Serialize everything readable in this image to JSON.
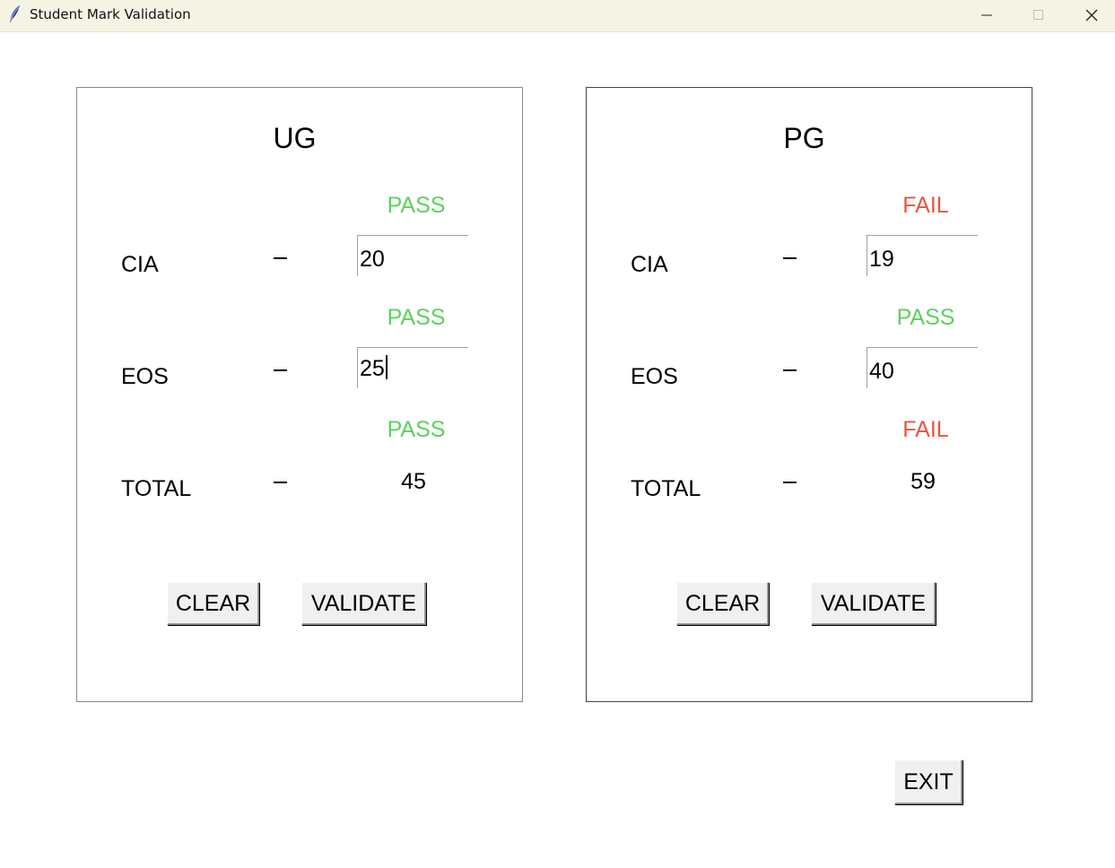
{
  "window": {
    "title": "Student Mark Validation",
    "icon": "feather-icon"
  },
  "ug": {
    "title": "UG",
    "cia": {
      "label": "CIA",
      "status": "PASS",
      "value": "20"
    },
    "eos": {
      "label": "EOS",
      "status": "PASS",
      "value": "25"
    },
    "total": {
      "label": "TOTAL",
      "status": "PASS",
      "value": "45"
    },
    "clear_label": "CLEAR",
    "validate_label": "VALIDATE"
  },
  "pg": {
    "title": "PG",
    "cia": {
      "label": "CIA",
      "status": "FAIL",
      "value": "19"
    },
    "eos": {
      "label": "EOS",
      "status": "PASS",
      "value": "40"
    },
    "total": {
      "label": "TOTAL",
      "status": "FAIL",
      "value": "59"
    },
    "clear_label": "CLEAR",
    "validate_label": "VALIDATE"
  },
  "exit_label": "EXIT",
  "colors": {
    "pass": "#5bd25b",
    "fail": "#e8543c",
    "titlebar": "#f5f4e4"
  }
}
